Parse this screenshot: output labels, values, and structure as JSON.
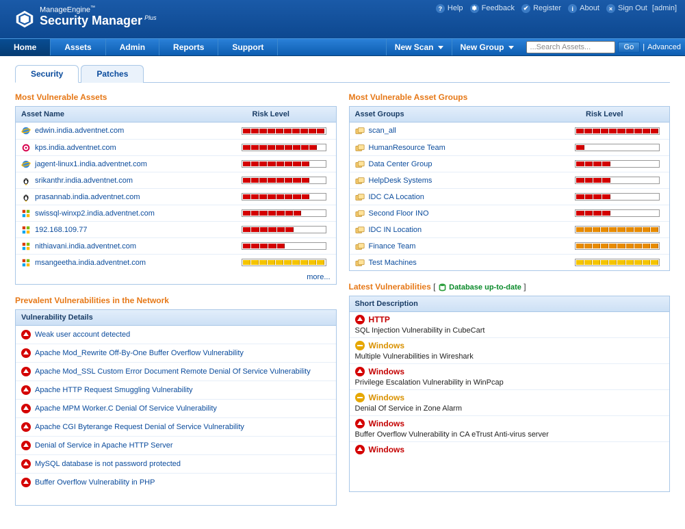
{
  "top": {
    "brand_line1": "ManageEngine",
    "brand_tm": "™",
    "brand_line2": "Security Manager",
    "brand_plus": "Plus",
    "help": "Help",
    "feedback": "Feedback",
    "register": "Register",
    "about": "About",
    "signout": "Sign Out",
    "user": "[admin]"
  },
  "nav": {
    "home": "Home",
    "assets": "Assets",
    "admin": "Admin",
    "reports": "Reports",
    "support": "Support",
    "newscan": "New Scan",
    "newgroup": "New Group",
    "search_placeholder": "...Search Assets...",
    "go": "Go",
    "advanced": "Advanced"
  },
  "tabs": {
    "security": "Security",
    "patches": "Patches"
  },
  "assets": {
    "title": "Most Vulnerable Assets",
    "hd1": "Asset Name",
    "hd2": "Risk Level",
    "more": "more...",
    "items": [
      {
        "name": "edwin.india.adventnet.com",
        "ic": "ie",
        "fill": 10,
        "col": "r"
      },
      {
        "name": "kps.india.adventnet.com",
        "ic": "deb",
        "fill": 9,
        "col": "r"
      },
      {
        "name": "jagent-linux1.india.adventnet.com",
        "ic": "ie",
        "fill": 8,
        "col": "r"
      },
      {
        "name": "srikanthr.india.adventnet.com",
        "ic": "tux",
        "fill": 8,
        "col": "r"
      },
      {
        "name": "prasannab.india.adventnet.com",
        "ic": "tux",
        "fill": 8,
        "col": "r"
      },
      {
        "name": "swissql-winxp2.india.adventnet.com",
        "ic": "win",
        "fill": 7,
        "col": "r"
      },
      {
        "name": "192.168.109.77",
        "ic": "win",
        "fill": 6,
        "col": "r"
      },
      {
        "name": "nithiavani.india.adventnet.com",
        "ic": "win",
        "fill": 5,
        "col": "r"
      },
      {
        "name": "msangeetha.india.adventnet.com",
        "ic": "win",
        "fill": 10,
        "col": "y"
      }
    ]
  },
  "groups": {
    "title": "Most Vulnerable Asset Groups",
    "hd1": "Asset Groups",
    "hd2": "Risk Level",
    "items": [
      {
        "name": "scan_all",
        "fill": 10,
        "col": "r"
      },
      {
        "name": "HumanResource Team",
        "fill": 1,
        "col": "r"
      },
      {
        "name": "Data Center Group",
        "fill": 4,
        "col": "r"
      },
      {
        "name": "HelpDesk Systems",
        "fill": 4,
        "col": "r"
      },
      {
        "name": "IDC CA Location",
        "fill": 4,
        "col": "r"
      },
      {
        "name": "Second Floor INO",
        "fill": 4,
        "col": "r"
      },
      {
        "name": "IDC IN Location",
        "fill": 10,
        "col": "o"
      },
      {
        "name": "Finance Team",
        "fill": 10,
        "col": "o"
      },
      {
        "name": "Test Machines",
        "fill": 10,
        "col": "y"
      }
    ]
  },
  "prev": {
    "title": "Prevalent Vulnerabilities in the Network",
    "hd": "Vulnerability Details",
    "items": [
      "Weak user account detected",
      "Apache Mod_Rewrite Off-By-One Buffer Overflow Vulnerability",
      "Apache Mod_SSL Custom Error Document Remote Denial Of Service Vulnerability",
      "Apache HTTP Request Smuggling Vulnerability",
      "Apache MPM Worker.C Denial Of Service Vulnerability",
      "Apache CGI Byterange Request Denial of Service Vulnerability",
      "Denial of Service in Apache HTTP Server",
      "MySQL database is not password protected",
      "Buffer Overflow Vulnerability in PHP"
    ]
  },
  "latest": {
    "title": "Latest Vulnerabilities",
    "db": "Database up-to-date",
    "hd": "Short Description",
    "items": [
      {
        "sev": "hi",
        "cat": "HTTP",
        "desc": "SQL Injection Vulnerability in CubeCart"
      },
      {
        "sev": "md",
        "cat": "Windows",
        "desc": "Multiple Vulnerabilities in Wireshark"
      },
      {
        "sev": "hi",
        "cat": "Windows",
        "desc": "Privilege Escalation Vulnerability in WinPcap"
      },
      {
        "sev": "md",
        "cat": "Windows",
        "desc": "Denial Of Service in Zone Alarm"
      },
      {
        "sev": "hi",
        "cat": "Windows",
        "desc": "Buffer Overflow Vulnerability in CA eTrust Anti-virus server"
      },
      {
        "sev": "hi",
        "cat": "Windows",
        "desc": ""
      }
    ]
  }
}
